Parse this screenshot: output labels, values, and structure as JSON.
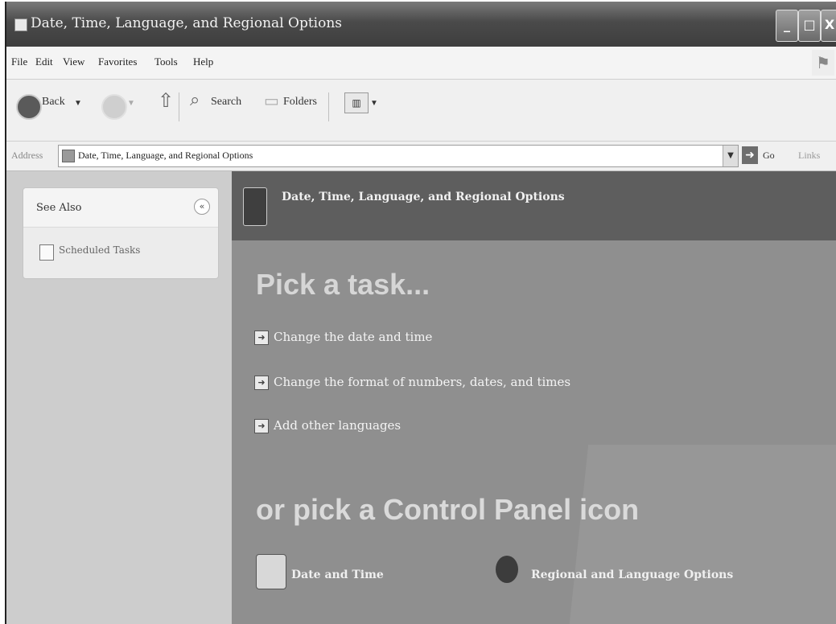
{
  "window": {
    "title": "Date, Time, Language, and Regional Options",
    "controls": [
      "_",
      "□",
      "X"
    ]
  },
  "menu": {
    "items": [
      "File",
      "Edit",
      "View",
      "Favorites",
      "Tools",
      "Help"
    ]
  },
  "toolbar": {
    "back_label": "Back",
    "search_label": "Search",
    "folders_label": "Folders"
  },
  "address": {
    "label": "Address",
    "value": "Date, Time, Language, and Regional Options",
    "go_label": "Go",
    "links_label": "Links"
  },
  "sidebar": {
    "see_also_title": "See Also",
    "collapse_glyph": "«",
    "items": [
      {
        "label": "Scheduled Tasks",
        "icon": "scheduled-tasks-icon"
      }
    ]
  },
  "content": {
    "header_title": "Date, Time, Language, and Regional Options",
    "pick_task_heading": "Pick a task...",
    "tasks": [
      {
        "label": "Change the date and time"
      },
      {
        "label": "Change the format of numbers, dates, and times"
      },
      {
        "label": "Add other languages"
      }
    ],
    "pick_icon_heading": "or pick a Control Panel icon",
    "icons": [
      {
        "label": "Date and Time",
        "icon": "date-time-icon"
      },
      {
        "label": "Regional and Language Options",
        "icon": "globe-icon"
      }
    ]
  }
}
